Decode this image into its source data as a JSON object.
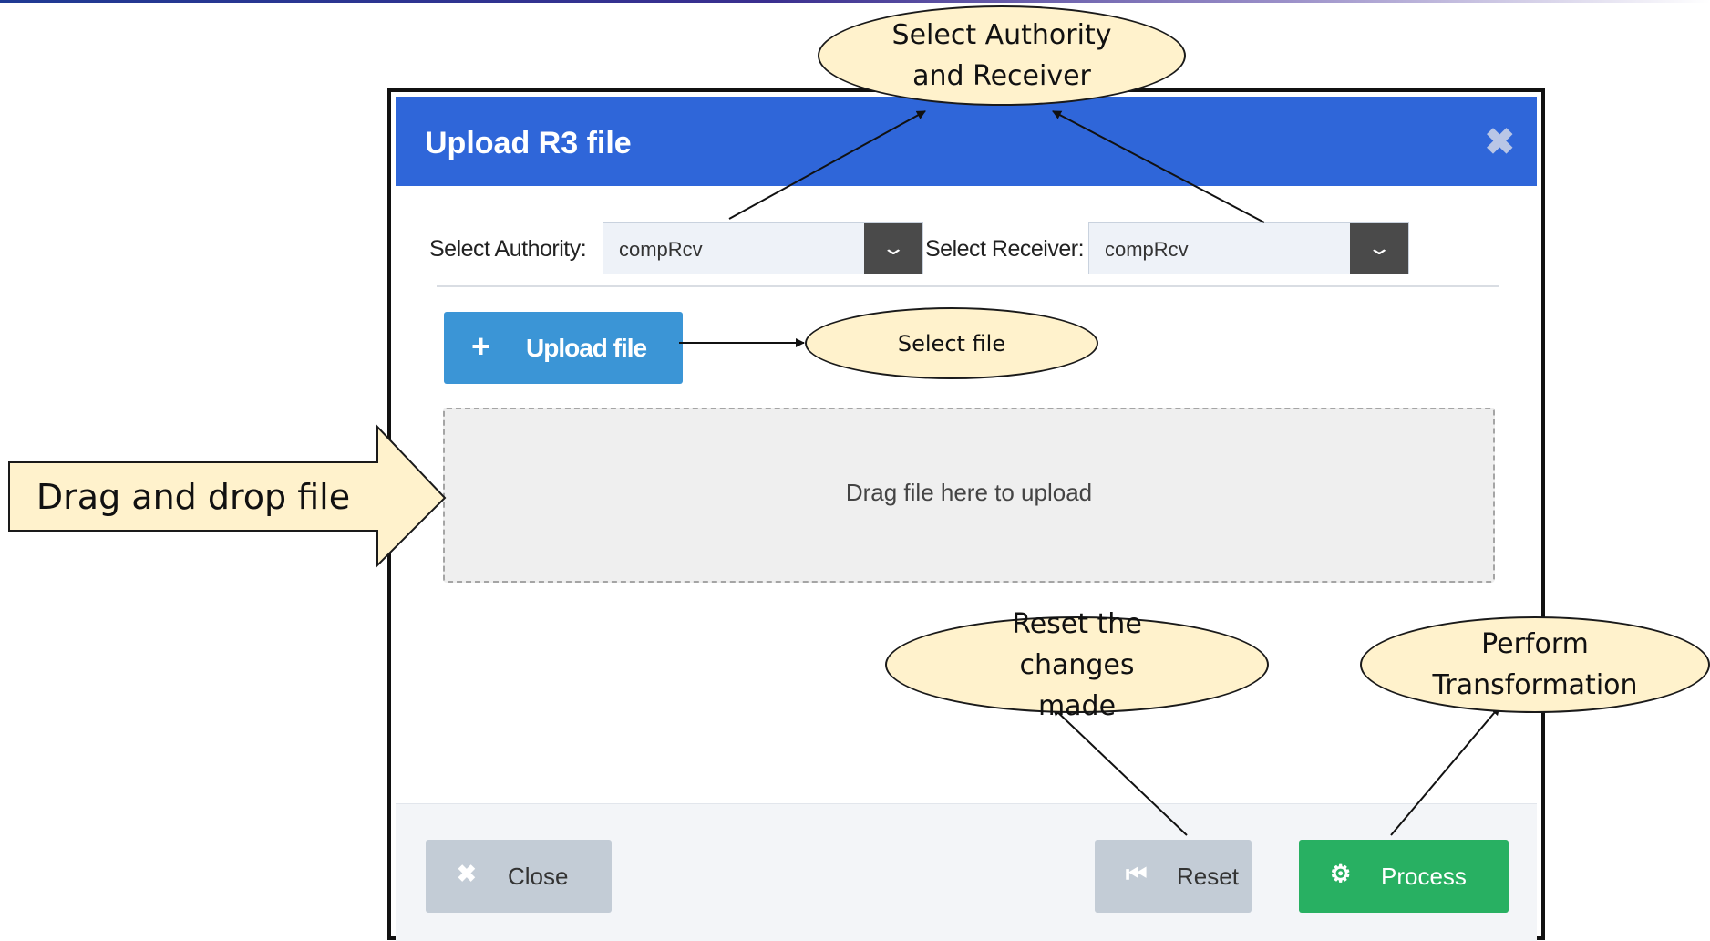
{
  "dialog": {
    "title": "Upload R3 file",
    "close_glyph": "✖",
    "authority": {
      "label": "Select Authority:",
      "value": "compRcv"
    },
    "receiver": {
      "label": "Select Receiver:",
      "value": "compRcv"
    },
    "upload_button": {
      "icon": "plus-icon",
      "glyph": "+",
      "label": "Upload file"
    },
    "dropzone_text": "Drag file here to upload",
    "footer": {
      "close": {
        "icon": "x-icon",
        "glyph": "✖",
        "label": "Close"
      },
      "reset": {
        "icon": "skip-back-icon",
        "glyph": "⏮",
        "label": "Reset"
      },
      "process": {
        "icon": "gears-icon",
        "glyph": "⚙",
        "label": "Process"
      }
    }
  },
  "annotations": {
    "select_authority_receiver": "Select Authority and Receiver",
    "select_file": "Select file",
    "drag_drop": "Drag and drop file",
    "reset": "Reset the changes made",
    "process": "Perform Transformation"
  },
  "colors": {
    "header": "#2f66d9",
    "upload_button": "#3b95d6",
    "process_button": "#28b062",
    "neutral_button": "#c3ccd6",
    "callout_fill": "#fff2cc"
  }
}
